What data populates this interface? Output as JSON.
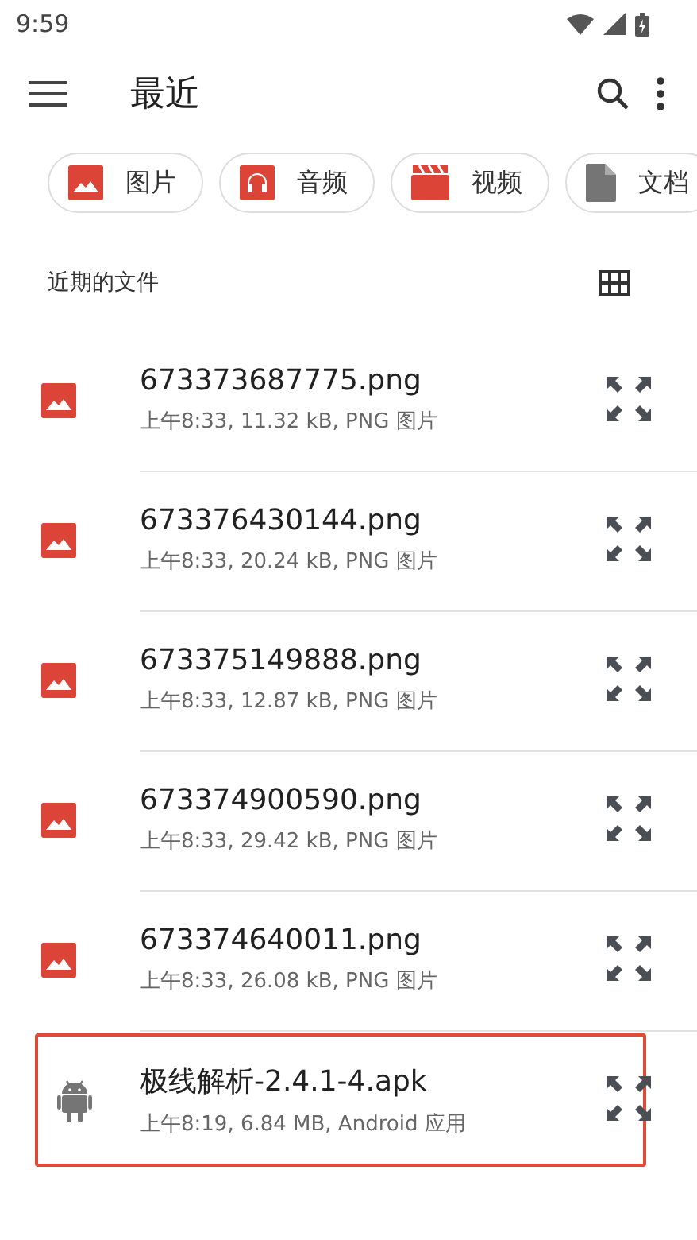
{
  "status_bar": {
    "time": "9:59"
  },
  "toolbar": {
    "title": "最近"
  },
  "chips": [
    {
      "label": "图片",
      "kind": "image"
    },
    {
      "label": "音频",
      "kind": "audio"
    },
    {
      "label": "视频",
      "kind": "video"
    },
    {
      "label": "文档",
      "kind": "document"
    }
  ],
  "section": {
    "title": "近期的文件"
  },
  "files": [
    {
      "name": "673373687775.png",
      "details": "上午8:33, 11.32 kB, PNG 图片",
      "kind": "image"
    },
    {
      "name": "673376430144.png",
      "details": "上午8:33, 20.24 kB, PNG 图片",
      "kind": "image"
    },
    {
      "name": "673375149888.png",
      "details": "上午8:33, 12.87 kB, PNG 图片",
      "kind": "image"
    },
    {
      "name": "673374900590.png",
      "details": "上午8:33, 29.42 kB, PNG 图片",
      "kind": "image"
    },
    {
      "name": "673374640011.png",
      "details": "上午8:33, 26.08 kB, PNG 图片",
      "kind": "image"
    },
    {
      "name": "极线解析-2.4.1-4.apk",
      "details": "上午8:19, 6.84 MB, Android 应用",
      "kind": "apk",
      "highlighted": true
    }
  ]
}
